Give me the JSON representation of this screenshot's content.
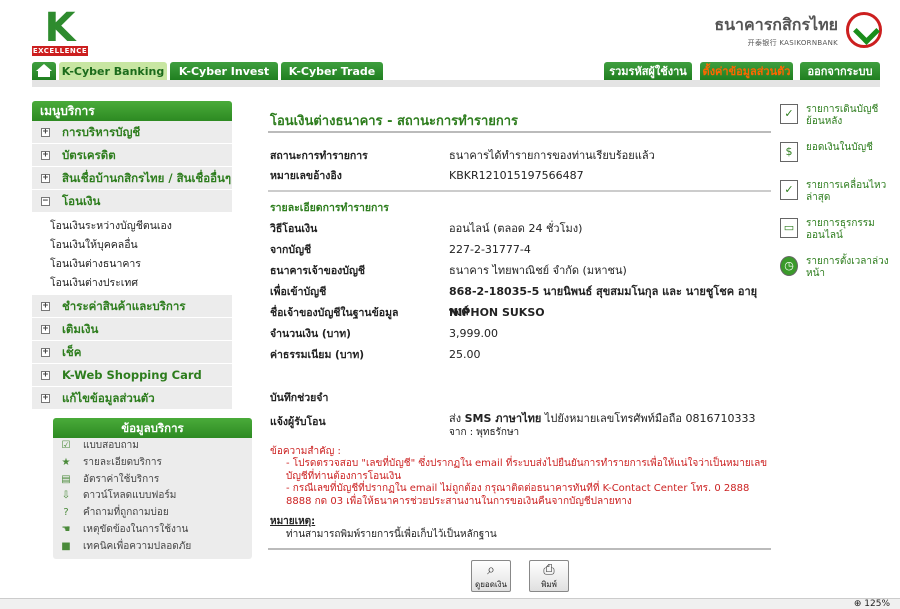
{
  "header": {
    "logo_letter": "K",
    "logo_tag": "EXCELLENCE",
    "bank_name_th": "ธนาคารกสิกรไทย",
    "bank_name_en": "开泰银行 KASIKORNBANK"
  },
  "tabs": {
    "cyber_banking": "K-Cyber Banking",
    "cyber_invest": "K-Cyber Invest",
    "cyber_trade": "K-Cyber Trade",
    "password": "รวมรหัสผู้ใช้งาน",
    "profile": "ตั้งค่าข้อมูลส่วนตัว",
    "logout": "ออกจากระบบ"
  },
  "menu": {
    "title": "เมนูบริการ",
    "items": [
      {
        "label": "การบริหารบัญชี",
        "toggle": "+"
      },
      {
        "label": "บัตรเครดิต",
        "toggle": "+"
      },
      {
        "label": "สินเชื่อบ้านกสิกรไทย / สินเชื่ออื่นๆ",
        "toggle": "+"
      },
      {
        "label": "โอนเงิน",
        "toggle": "−"
      }
    ],
    "submenu": [
      "โอนเงินระหว่างบัญชีตนเอง",
      "โอนเงินให้บุคคลอื่น",
      "โอนเงินต่างธนาคาร",
      "โอนเงินต่างประเทศ"
    ],
    "items_after": [
      {
        "label": "ชำระค่าสินค้าและบริการ",
        "toggle": "+"
      },
      {
        "label": "เติมเงิน",
        "toggle": "+"
      },
      {
        "label": "เช็ค",
        "toggle": "+"
      },
      {
        "label": "K-Web Shopping Card",
        "toggle": "+"
      },
      {
        "label": "แก้ไขข้อมูลส่วนตัว",
        "toggle": "+"
      }
    ]
  },
  "services": {
    "title": "ข้อมูลบริการ",
    "items": [
      {
        "label": "แบบสอบถาม",
        "icon": "checkbox-icon"
      },
      {
        "label": "รายละเอียดบริการ",
        "icon": "star-icon"
      },
      {
        "label": "อัตราค่าใช้บริการ",
        "icon": "calculator-icon"
      },
      {
        "label": "ดาวน์โหลดแบบฟอร์ม",
        "icon": "download-icon"
      },
      {
        "label": "คำถามที่ถูกถามบ่อย",
        "icon": "question-icon"
      },
      {
        "label": "เหตุขัดข้องในการใช้งาน",
        "icon": "hand-icon"
      },
      {
        "label": "เทคนิคเพื่อความปลอดภัย",
        "icon": "lock-icon"
      }
    ]
  },
  "main": {
    "title": "โอนเงินต่างธนาคาร - สถานะการทำรายการ",
    "status_label": "สถานะการทำรายการ",
    "status_value": "ธนาคารได้ทำรายการของท่านเรียบร้อยแล้ว",
    "ref_label": "หมายเลขอ้างอิง",
    "ref_value": "KBKR121015197566487",
    "details_heading": "รายละเอียดการทำรายการ",
    "fields": [
      {
        "label": "วิธีโอนเงิน",
        "value": "ออนไลน์ (ตลอด 24 ชั่วโมง)"
      },
      {
        "label": "จากบัญชี",
        "value": "227-2-31777-4"
      },
      {
        "label": "ธนาคารเจ้าของบัญชี",
        "value": "ธนาคาร ไทยพาณิชย์ จำกัด (มหาชน)"
      },
      {
        "label": "เพื่อเข้าบัญชี",
        "value": "868-2-18035-5 นายนิพนธ์ สุขสมมโนกุล และ นายชูโชค อายุพงศ์"
      },
      {
        "label": "ชื่อเจ้าของบัญชีในฐานข้อมูล",
        "value": "NIPHON SUKSO"
      },
      {
        "label": "จำนวนเงิน (บาท)",
        "value": "3,999.00"
      },
      {
        "label": "ค่าธรรมเนียม (บาท)",
        "value": "25.00"
      }
    ],
    "memo_label": "บันทึกช่วยจำ",
    "notify_label": "แจ้งผู้รับโอน",
    "notify_line1_prefix": "ส่ง",
    "notify_line1_bold": "SMS ภาษาไทย",
    "notify_line1_suffix": "ไปยังหมายเลขโทรศัพท์มือถือ 0816710333",
    "notify_line2": "จาก : พุทธรักษา",
    "notice_head": "ข้อความสำคัญ :",
    "notice_1": "- โปรดตรวจสอบ \"เลขที่บัญชี\" ซึ่งปรากฏใน email ที่ระบบส่งไปยืนยันการทำรายการเพื่อให้แน่ใจว่าเป็นหมายเลขบัญชีที่ท่านต้องการโอนเงิน",
    "notice_2": "- กรณีเลขที่บัญชีที่ปรากฏใน email ไม่ถูกต้อง กรุณาติดต่อธนาคารทันทีที่ K-Contact Center โทร. 0 2888 8888 กด 03 เพื่อให้ธนาคารช่วยประสานงานในการขอเงินคืนจากบัญชีปลายทาง",
    "remark_head": "หมายเหตุ:",
    "remark_body": "ท่านสามารถพิมพ์รายการนี้เพื่อเก็บไว้เป็นหลักฐาน",
    "btn_balance": "ดูยอดเงิน",
    "btn_print": "พิมพ์"
  },
  "shortcuts": [
    {
      "label": "รายการเดินบัญชีย้อนหลัง",
      "icon": "statement-icon"
    },
    {
      "label": "ยอดเงินในบัญชี",
      "icon": "money-bag-icon"
    },
    {
      "label": "รายการเคลื่อนไหวล่าสุด",
      "icon": "recent-transactions-icon"
    },
    {
      "label": "รายการธุรกรรมออนไลน์",
      "icon": "online-transactions-icon"
    },
    {
      "label": "รายการตั้งเวลาล่วงหน้า",
      "icon": "clock-icon"
    }
  ],
  "statusbar": {
    "zoom": "125%"
  }
}
